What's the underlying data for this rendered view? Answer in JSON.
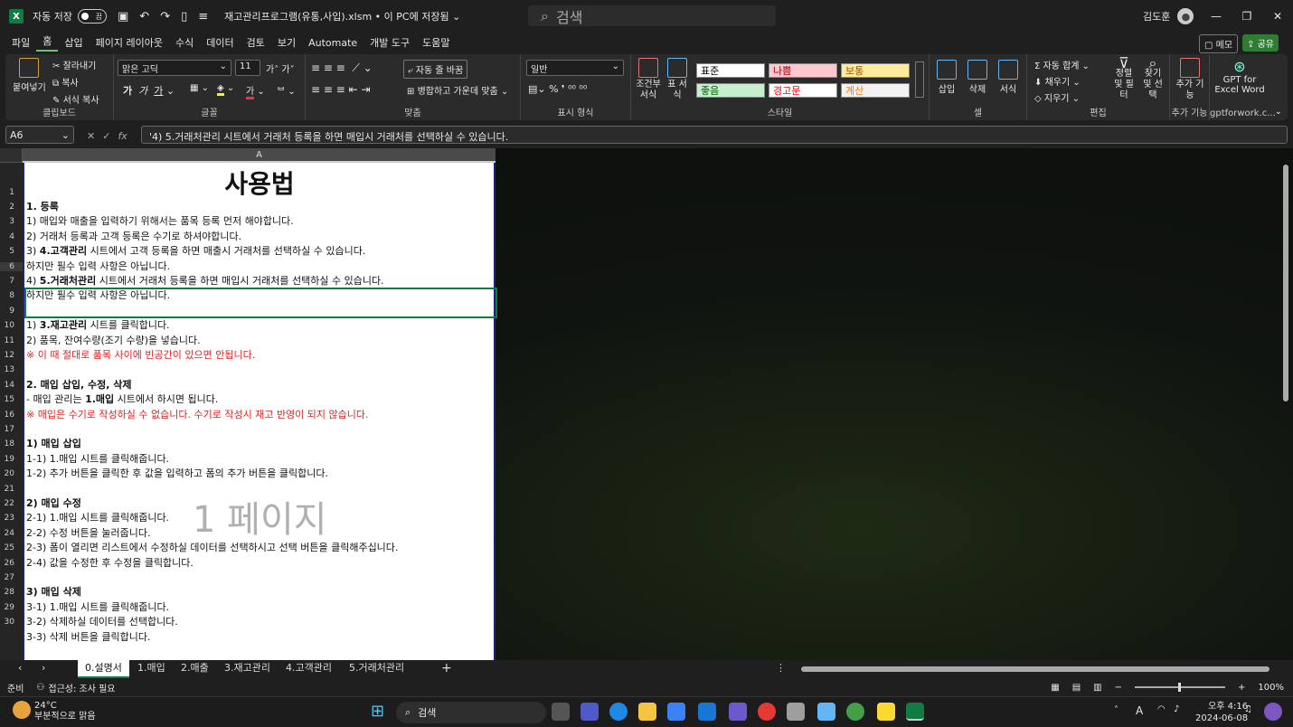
{
  "titlebar": {
    "autosave_label": "자동 저장",
    "autosave_state": "끔",
    "doc_title": "재고관리프로그램(유통,사입).xlsm • 이 PC에 저장됨 ⌄",
    "search_placeholder": "검색",
    "user_name": "김도훈"
  },
  "menu": {
    "tabs": [
      "파일",
      "홈",
      "삽입",
      "페이지 레이아웃",
      "수식",
      "데이터",
      "검토",
      "보기",
      "Automate",
      "개발 도구",
      "도움말"
    ],
    "memo": "메모",
    "share": "공유"
  },
  "ribbon": {
    "clipboard": {
      "paste": "붙여넣기",
      "cut": "잘라내기",
      "copy": "복사",
      "format_painter": "서식 복사",
      "label": "클립보드"
    },
    "font": {
      "name": "맑은 고딕",
      "size": "11",
      "label": "글꼴"
    },
    "align": {
      "wrap": "자동 줄 바꿈",
      "merge": "병합하고 가운데 맞춤",
      "label": "맞춤"
    },
    "number": {
      "format": "일반",
      "label": "표시 형식"
    },
    "styles": {
      "cond_format": "조건부 서식",
      "table_format": "표 서식",
      "cells": [
        {
          "label": "표준",
          "bg": "#ffffff",
          "fg": "#000000"
        },
        {
          "label": "나쁨",
          "bg": "#ffc7ce",
          "fg": "#9c0006"
        },
        {
          "label": "보통",
          "bg": "#ffeb9c",
          "fg": "#9c5700"
        },
        {
          "label": "좋음",
          "bg": "#c6efce",
          "fg": "#006100"
        },
        {
          "label": "경고문",
          "bg": "#ffffff",
          "fg": "#ff0000"
        },
        {
          "label": "계산",
          "bg": "#f2f2f2",
          "fg": "#fa7d00"
        }
      ],
      "label": "스타일"
    },
    "cells": {
      "insert": "삽입",
      "delete": "삭제",
      "format": "서식",
      "label": "셀"
    },
    "editing": {
      "autosum": "자동 합계",
      "fill": "채우기",
      "clear": "지우기",
      "sort": "정렬 및 필터",
      "find": "찾기 및 선택",
      "label": "편집"
    },
    "addins": {
      "addins": "추가 기능",
      "label": "추가 기능"
    },
    "gpt": {
      "label1": "GPT for",
      "label2": "Excel Word",
      "label": "gptforwork.c..."
    }
  },
  "formula_bar": {
    "name_box": "A6",
    "fx": "fx",
    "formula": "'4) 5.거래처관리 시트에서 거래처 등록을 하면 매입시 거래처를 선택하실 수 있습니다."
  },
  "grid": {
    "column": "A",
    "title": "사용법",
    "row_numbers": [
      "1",
      "2",
      "3",
      "4",
      "5",
      "6",
      "7",
      "8",
      "9",
      "10",
      "11",
      "12",
      "13",
      "14",
      "15",
      "16",
      "17",
      "18",
      "19",
      "20",
      "21",
      "22",
      "23",
      "24",
      "25",
      "26",
      "27",
      "28",
      "29",
      "30"
    ],
    "lines": [
      {
        "parts": [
          {
            "t": "1. 등록",
            "b": true
          }
        ]
      },
      {
        "parts": [
          {
            "t": "1) 매입와 매출을 입력하기 위해서는 품목 등록 먼저 해야합니다."
          }
        ]
      },
      {
        "parts": [
          {
            "t": "2) 거래처 등록과 고객 등록은 수기로 하셔야합니다."
          }
        ]
      },
      {
        "parts": [
          {
            "t": "3) "
          },
          {
            "t": "4.고객관리",
            "b": true
          },
          {
            "t": " 시트에서 고객 등록을 하면 매출시 거래처를 선택하실 수 있습니다."
          }
        ]
      },
      {
        "parts": [
          {
            "t": "하지만 필수 입력 사항은 아닙니다."
          }
        ]
      },
      {
        "parts": [
          {
            "t": "4) "
          },
          {
            "t": "5.거래처관리",
            "b": true
          },
          {
            "t": " 시트에서 거래처 등록을 하면 매입시 거래처를 선택하실 수 있습니다."
          }
        ]
      },
      {
        "parts": [
          {
            "t": "하지만 필수 입력 사항은 아닙니다."
          }
        ]
      },
      {
        "parts": [
          {
            "t": ""
          }
        ]
      },
      {
        "parts": [
          {
            "t": "1) "
          },
          {
            "t": "3.재고관리",
            "b": true
          },
          {
            "t": " 시트를 클릭합니다."
          }
        ]
      },
      {
        "parts": [
          {
            "t": "2) 품목, 잔여수량(조기 수량)을 넣습니다."
          }
        ]
      },
      {
        "red": true,
        "parts": [
          {
            "t": "※ 이 때 절대로 품목 사이에 빈공간이 있으면 안됩니다."
          }
        ]
      },
      {
        "parts": [
          {
            "t": ""
          }
        ]
      },
      {
        "parts": [
          {
            "t": "2. 매입 삽입, 수정, 삭제",
            "b": true
          }
        ]
      },
      {
        "parts": [
          {
            "t": "- 매입 관리는 "
          },
          {
            "t": "1.매입",
            "b": true
          },
          {
            "t": " 시트에서 하시면 됩니다."
          }
        ]
      },
      {
        "red": true,
        "parts": [
          {
            "t": "※ 매입은 수기로 작성하실 수 없습니다. 수기로 작성시 재고 반영이 되지 않습니다."
          }
        ]
      },
      {
        "parts": [
          {
            "t": ""
          }
        ]
      },
      {
        "parts": [
          {
            "t": "1) 매입 삽입",
            "b": true
          }
        ]
      },
      {
        "parts": [
          {
            "t": "1-1) 1.매입 시트를 클릭해줍니다."
          }
        ]
      },
      {
        "parts": [
          {
            "t": "1-2) 추가 버튼을 클릭한 후 값을 입력하고 폼의 추가 버튼을 클릭합니다."
          }
        ]
      },
      {
        "parts": [
          {
            "t": ""
          }
        ]
      },
      {
        "parts": [
          {
            "t": "2) 매입 수정",
            "b": true
          }
        ]
      },
      {
        "parts": [
          {
            "t": "2-1) 1.매입 시트를 클릭해줍니다."
          }
        ]
      },
      {
        "parts": [
          {
            "t": "2-2) 수정 버튼을 눌러줍니다."
          }
        ]
      },
      {
        "parts": [
          {
            "t": "2-3) 폼이 열리면 리스트에서 수정하실 데이터를 선택하시고 선택 버튼을 클릭해주십니다."
          }
        ]
      },
      {
        "parts": [
          {
            "t": "2-4) 값을 수정한 후 수정을 클릭합니다."
          }
        ]
      },
      {
        "parts": [
          {
            "t": ""
          }
        ]
      },
      {
        "parts": [
          {
            "t": "3) 매입 삭제",
            "b": true
          }
        ]
      },
      {
        "parts": [
          {
            "t": "3-1) 1.매입 시트를 클릭해줍니다."
          }
        ]
      },
      {
        "parts": [
          {
            "t": "3-2) 삭제하실 데이터를 선택합니다."
          }
        ]
      },
      {
        "parts": [
          {
            "t": "3-3) 삭제 버튼을 클릭합니다."
          }
        ]
      }
    ],
    "watermark": "1 페이지"
  },
  "sheet_tabs": {
    "tabs": [
      "0.설명서",
      "1.매입",
      "2.매출",
      "3.재고관리",
      "4.고객관리",
      "5.거래처관리"
    ],
    "active": 0,
    "add": "+"
  },
  "status": {
    "ready": "준비",
    "accessibility": "접근성: 조사 필요",
    "zoom": "100%"
  },
  "taskbar": {
    "weather_temp": "24°C",
    "weather_desc": "부분적으로 맑음",
    "search": "검색",
    "time": "오후 4:16",
    "date": "2024-06-08",
    "ime": "A"
  }
}
